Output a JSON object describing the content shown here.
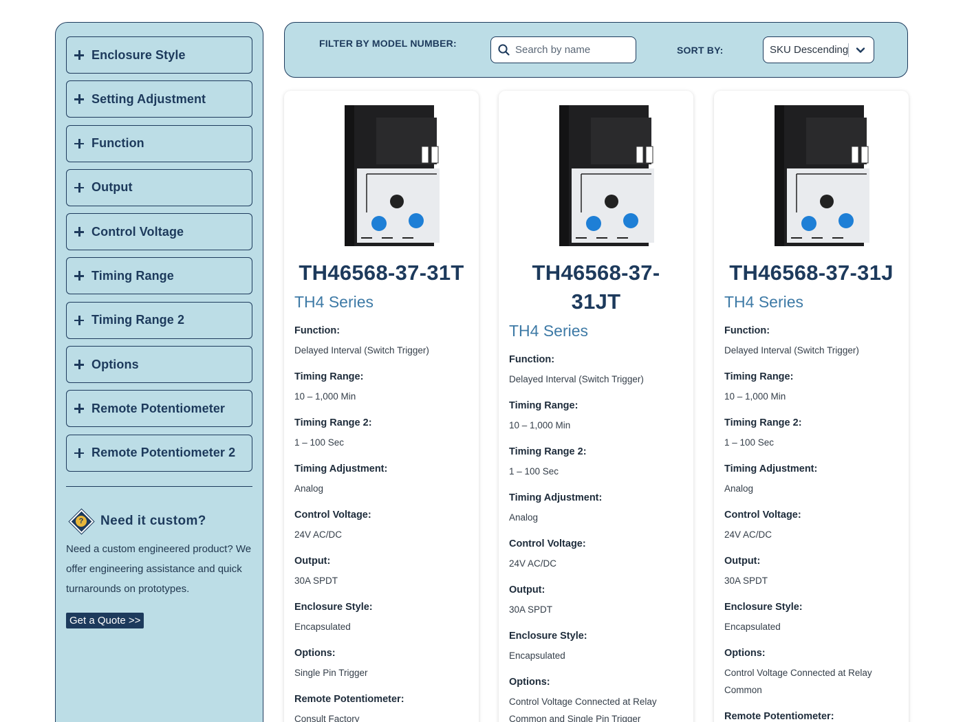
{
  "sidebar": {
    "facets": [
      {
        "label": "Enclosure Style"
      },
      {
        "label": "Setting Adjustment"
      },
      {
        "label": "Function"
      },
      {
        "label": "Output"
      },
      {
        "label": "Control Voltage"
      },
      {
        "label": "Timing Range"
      },
      {
        "label": "Timing Range 2"
      },
      {
        "label": "Options"
      },
      {
        "label": "Remote Potentiometer"
      },
      {
        "label": "Remote Potentiometer 2"
      }
    ],
    "custom": {
      "title": "Need it custom?",
      "body": "Need a custom engineered product? We offer engineering assistance and quick turnarounds on prototypes.",
      "button": "Get a Quote >>",
      "icon": "question-diamond-icon"
    }
  },
  "filter": {
    "label": "FILTER BY MODEL NUMBER:",
    "search_placeholder": "Search by name",
    "search_value": "",
    "sort_label": "SORT BY:",
    "sort_value": "SKU Descending"
  },
  "products": [
    {
      "sku": "TH46568-37-31T",
      "series": "TH4 Series",
      "specs": [
        {
          "k": "Function:",
          "v": "Delayed Interval (Switch Trigger)"
        },
        {
          "k": "Timing Range:",
          "v": "10 – 1,000 Min"
        },
        {
          "k": "Timing Range 2:",
          "v": "1 – 100 Sec"
        },
        {
          "k": "Timing Adjustment:",
          "v": "Analog"
        },
        {
          "k": "Control Voltage:",
          "v": "24V AC/DC"
        },
        {
          "k": "Output:",
          "v": "30A SPDT"
        },
        {
          "k": "Enclosure Style:",
          "v": "Encapsulated"
        },
        {
          "k": "Options:",
          "v": "Single Pin Trigger"
        },
        {
          "k": "Remote Potentiometer:",
          "v": "Consult Factory"
        }
      ]
    },
    {
      "sku": "TH46568-37-31JT",
      "series": "TH4 Series",
      "specs": [
        {
          "k": "Function:",
          "v": "Delayed Interval (Switch Trigger)"
        },
        {
          "k": "Timing Range:",
          "v": "10 – 1,000 Min"
        },
        {
          "k": "Timing Range 2:",
          "v": "1 – 100 Sec"
        },
        {
          "k": "Timing Adjustment:",
          "v": "Analog"
        },
        {
          "k": "Control Voltage:",
          "v": "24V AC/DC"
        },
        {
          "k": "Output:",
          "v": "30A SPDT"
        },
        {
          "k": "Enclosure Style:",
          "v": "Encapsulated"
        },
        {
          "k": "Options:",
          "v": "Control Voltage Connected at Relay Common and Single Pin Trigger"
        }
      ]
    },
    {
      "sku": "TH46568-37-31J",
      "series": "TH4 Series",
      "specs": [
        {
          "k": "Function:",
          "v": "Delayed Interval (Switch Trigger)"
        },
        {
          "k": "Timing Range:",
          "v": "10 – 1,000 Min"
        },
        {
          "k": "Timing Range 2:",
          "v": "1 – 100 Sec"
        },
        {
          "k": "Timing Adjustment:",
          "v": "Analog"
        },
        {
          "k": "Control Voltage:",
          "v": "24V AC/DC"
        },
        {
          "k": "Output:",
          "v": "30A SPDT"
        },
        {
          "k": "Enclosure Style:",
          "v": "Encapsulated"
        },
        {
          "k": "Options:",
          "v": "Control Voltage Connected at Relay Common"
        },
        {
          "k": "Remote Potentiometer:",
          "v": ""
        }
      ]
    }
  ]
}
